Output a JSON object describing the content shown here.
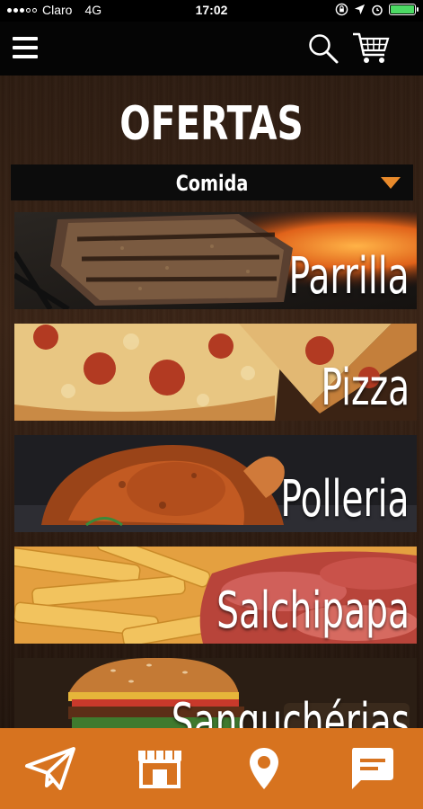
{
  "status_bar": {
    "carrier": "Claro",
    "network": "4G",
    "time": "17:02"
  },
  "header": {
    "menu_icon": "hamburger-menu-icon",
    "search_icon": "search-icon",
    "cart_icon": "shopping-cart-icon"
  },
  "page": {
    "title": "OFERTAS"
  },
  "category_select": {
    "selected": "Comida"
  },
  "categories": [
    {
      "label": "Parrilla"
    },
    {
      "label": "Pizza"
    },
    {
      "label": "Polleria"
    },
    {
      "label": "Salchipapa"
    },
    {
      "label": "Sanguchérias"
    }
  ],
  "bottom_nav": {
    "items": [
      {
        "icon": "send-icon"
      },
      {
        "icon": "store-icon"
      },
      {
        "icon": "location-pin-icon"
      },
      {
        "icon": "chat-icon"
      }
    ]
  },
  "colors": {
    "accent": "#d7731f",
    "dropdown_arrow": "#e98a2b",
    "battery": "#4cd964"
  }
}
